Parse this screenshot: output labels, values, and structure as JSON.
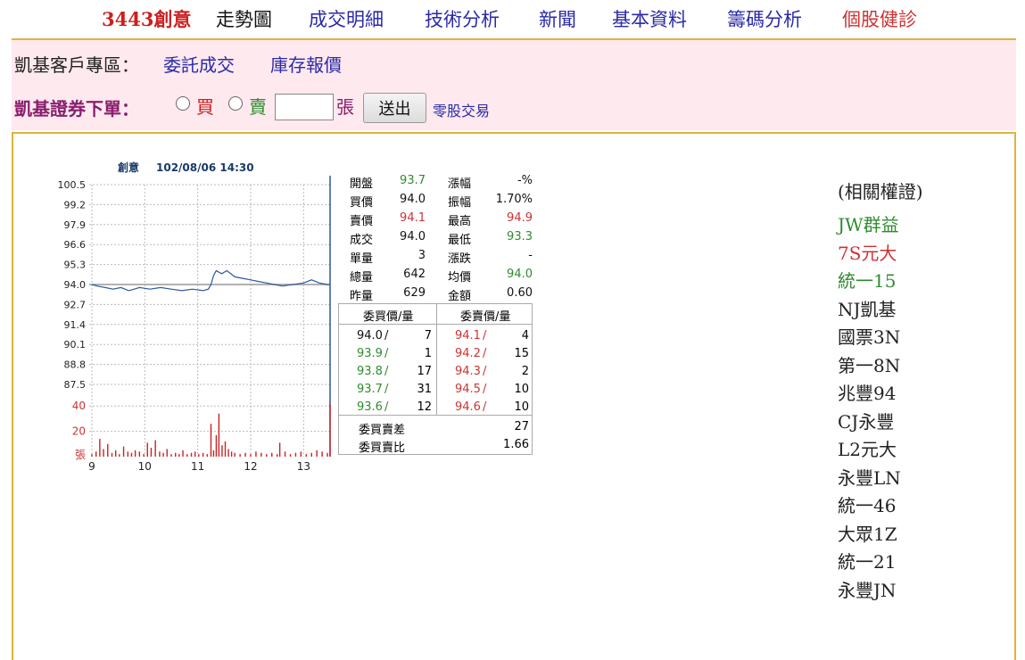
{
  "nav": {
    "items": [
      {
        "label": "3443創意",
        "color": "#cc1f1f",
        "bold": true
      },
      {
        "label": "走勢圖",
        "color": "#111111",
        "bold": false
      },
      {
        "label": "成交明細",
        "color": "#2a2aa8",
        "bold": false
      },
      {
        "label": "技術分析",
        "color": "#2a2aa8",
        "bold": false
      },
      {
        "label": "新聞",
        "color": "#2a2aa8",
        "bold": false
      },
      {
        "label": "基本資料",
        "color": "#2a2aa8",
        "bold": false
      },
      {
        "label": "籌碼分析",
        "color": "#2a2aa8",
        "bold": false
      },
      {
        "label": "個股健診",
        "color": "#cc3333",
        "bold": false
      }
    ]
  },
  "customer": {
    "label": "凱基客戶專區：",
    "links": [
      "委託成交",
      "庫存報價"
    ]
  },
  "order": {
    "label": "凱基證券下單：",
    "buy": "買",
    "sell": "賣",
    "unit": "張",
    "qty_value": "",
    "submit": "送出",
    "odd_lot": "零股交易",
    "buy_color": "#cc1f1f",
    "sell_color": "#2e8b2e",
    "unit_color": "#8a1e6e"
  },
  "chart_data": {
    "type": "line",
    "title": "創意",
    "datetime": "102/08/06 14:30",
    "price_ticks": [
      "100.5",
      "99.2",
      "97.9",
      "96.6",
      "95.3",
      "94.0",
      "92.7",
      "91.4",
      "90.1",
      "88.8",
      "87.5"
    ],
    "volume_ticks": [
      "40",
      "20",
      "張"
    ],
    "x_ticks": [
      "9",
      "10",
      "11",
      "12",
      "13"
    ],
    "ylim": [
      87.5,
      100.5
    ],
    "ref_price": 94.0,
    "grid": true,
    "price_series": [
      [
        9.0,
        94.0
      ],
      [
        9.1,
        93.9
      ],
      [
        9.25,
        93.8
      ],
      [
        9.4,
        93.7
      ],
      [
        9.55,
        93.8
      ],
      [
        9.7,
        93.6
      ],
      [
        9.9,
        93.8
      ],
      [
        10.1,
        93.7
      ],
      [
        10.3,
        93.8
      ],
      [
        10.5,
        93.7
      ],
      [
        10.7,
        93.6
      ],
      [
        10.9,
        93.7
      ],
      [
        11.1,
        93.6
      ],
      [
        11.2,
        93.7
      ],
      [
        11.25,
        94.0
      ],
      [
        11.3,
        94.6
      ],
      [
        11.35,
        94.9
      ],
      [
        11.45,
        94.7
      ],
      [
        11.55,
        94.9
      ],
      [
        11.7,
        94.5
      ],
      [
        11.85,
        94.4
      ],
      [
        12.0,
        94.3
      ],
      [
        12.15,
        94.2
      ],
      [
        12.3,
        94.1
      ],
      [
        12.45,
        94.0
      ],
      [
        12.6,
        93.9
      ],
      [
        12.8,
        94.0
      ],
      [
        13.0,
        94.1
      ],
      [
        13.15,
        94.3
      ],
      [
        13.3,
        94.1
      ],
      [
        13.45,
        94.0
      ],
      [
        13.5,
        94.0
      ]
    ],
    "volume_series": [
      [
        9.0,
        2
      ],
      [
        9.08,
        4
      ],
      [
        9.15,
        14
      ],
      [
        9.22,
        6
      ],
      [
        9.3,
        10
      ],
      [
        9.38,
        3
      ],
      [
        9.45,
        5
      ],
      [
        9.52,
        2
      ],
      [
        9.6,
        8
      ],
      [
        9.68,
        4
      ],
      [
        9.75,
        3
      ],
      [
        9.82,
        5
      ],
      [
        9.9,
        4
      ],
      [
        9.98,
        2
      ],
      [
        10.05,
        11
      ],
      [
        10.12,
        7
      ],
      [
        10.2,
        13
      ],
      [
        10.28,
        4
      ],
      [
        10.35,
        3
      ],
      [
        10.42,
        6
      ],
      [
        10.5,
        2
      ],
      [
        10.58,
        3
      ],
      [
        10.65,
        2
      ],
      [
        10.72,
        5
      ],
      [
        10.8,
        2
      ],
      [
        10.88,
        3
      ],
      [
        10.95,
        4
      ],
      [
        11.02,
        2
      ],
      [
        11.1,
        3
      ],
      [
        11.18,
        2
      ],
      [
        11.25,
        26
      ],
      [
        11.3,
        5
      ],
      [
        11.35,
        17
      ],
      [
        11.4,
        34
      ],
      [
        11.46,
        9
      ],
      [
        11.52,
        12
      ],
      [
        11.58,
        6
      ],
      [
        11.64,
        4
      ],
      [
        11.7,
        3
      ],
      [
        11.8,
        2
      ],
      [
        11.9,
        3
      ],
      [
        12.0,
        2
      ],
      [
        12.1,
        4
      ],
      [
        12.2,
        3
      ],
      [
        12.3,
        2
      ],
      [
        12.4,
        3
      ],
      [
        12.5,
        2
      ],
      [
        12.55,
        11
      ],
      [
        12.65,
        4
      ],
      [
        12.75,
        2
      ],
      [
        12.85,
        3
      ],
      [
        12.95,
        4
      ],
      [
        13.05,
        2
      ],
      [
        13.15,
        3
      ],
      [
        13.25,
        5
      ],
      [
        13.35,
        4
      ],
      [
        13.45,
        3
      ],
      [
        13.5,
        42
      ]
    ]
  },
  "quote": {
    "left": [
      {
        "label": "開盤",
        "value": "93.7",
        "color": "#2e8b2e"
      },
      {
        "label": "買價",
        "value": "94.0",
        "color": "#111111"
      },
      {
        "label": "賣價",
        "value": "94.1",
        "color": "#cc3333"
      },
      {
        "label": "成交",
        "value": "94.0",
        "color": "#111111"
      },
      {
        "label": "單量",
        "value": "3",
        "color": "#111111"
      },
      {
        "label": "總量",
        "value": "642",
        "color": "#111111"
      },
      {
        "label": "昨量",
        "value": "629",
        "color": "#111111"
      }
    ],
    "right": [
      {
        "label": "漲幅",
        "value": "-%",
        "color": "#111111"
      },
      {
        "label": "振幅",
        "value": "1.70%",
        "color": "#111111"
      },
      {
        "label": "最高",
        "value": "94.9",
        "color": "#cc3333"
      },
      {
        "label": "最低",
        "value": "93.3",
        "color": "#2e8b2e"
      },
      {
        "label": "漲跌",
        "value": "-",
        "color": "#111111"
      },
      {
        "label": "均價",
        "value": "94.0",
        "color": "#2e8b2e"
      },
      {
        "label": "金額",
        "value": "0.60",
        "color": "#111111"
      }
    ]
  },
  "orderbook": {
    "bid_header": "委買價/量",
    "ask_header": "委賣價/量",
    "bids": [
      {
        "price": "94.0",
        "qty": "7",
        "color": "#111111"
      },
      {
        "price": "93.9",
        "qty": "1",
        "color": "#2e8b2e"
      },
      {
        "price": "93.8",
        "qty": "17",
        "color": "#2e8b2e"
      },
      {
        "price": "93.7",
        "qty": "31",
        "color": "#2e8b2e"
      },
      {
        "price": "93.6",
        "qty": "12",
        "color": "#2e8b2e"
      }
    ],
    "asks": [
      {
        "price": "94.1",
        "qty": "4",
        "color": "#cc3333"
      },
      {
        "price": "94.2",
        "qty": "15",
        "color": "#cc3333"
      },
      {
        "price": "94.3",
        "qty": "2",
        "color": "#cc3333"
      },
      {
        "price": "94.5",
        "qty": "10",
        "color": "#cc3333"
      },
      {
        "price": "94.6",
        "qty": "10",
        "color": "#cc3333"
      }
    ],
    "summary": [
      {
        "label": "委買賣差",
        "value": "27"
      },
      {
        "label": "委買賣比",
        "value": "1.66"
      }
    ]
  },
  "warrants": {
    "title": "(相關權證)",
    "items": [
      {
        "label": "JW群益",
        "color": "#2e8b2e"
      },
      {
        "label": "7S元大",
        "color": "#cc3333"
      },
      {
        "label": "統一15",
        "color": "#2e8b2e"
      },
      {
        "label": "NJ凱基",
        "color": "#222222"
      },
      {
        "label": "國票3N",
        "color": "#222222"
      },
      {
        "label": "第一8N",
        "color": "#222222"
      },
      {
        "label": "兆豐94",
        "color": "#222222"
      },
      {
        "label": "CJ永豐",
        "color": "#222222"
      },
      {
        "label": "L2元大",
        "color": "#222222"
      },
      {
        "label": "永豐LN",
        "color": "#222222"
      },
      {
        "label": "統一46",
        "color": "#222222"
      },
      {
        "label": "大眾1Z",
        "color": "#222222"
      },
      {
        "label": "統一21",
        "color": "#222222"
      },
      {
        "label": "永豐JN",
        "color": "#222222"
      }
    ]
  }
}
